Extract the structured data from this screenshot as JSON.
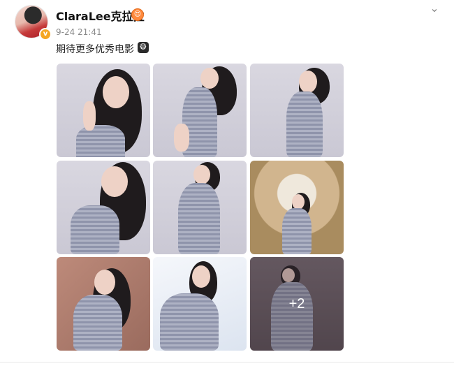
{
  "post": {
    "username": "ClaraLee克拉拉",
    "verified_badge": "v",
    "user_emoji": "😍",
    "timestamp": "9-24 21:41",
    "caption": "期待更多优秀电影",
    "caption_emoji": "😷",
    "more_menu_icon": "chevron-down-icon",
    "photo_overflow_count": "+2"
  },
  "photos": {
    "count_shown": 9,
    "overflow": 2
  },
  "colors": {
    "badge_orange": "#f5a623",
    "meta_gray": "#8a8a8a"
  }
}
